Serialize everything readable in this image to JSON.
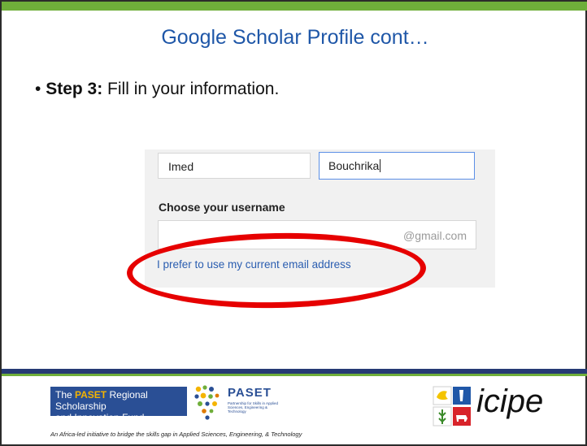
{
  "slide": {
    "title": "Google Scholar Profile cont…",
    "bullet_marker": "•",
    "bullet_bold": "Step 3:",
    "bullet_text": " Fill in your information."
  },
  "form": {
    "first_name_value": "Imed",
    "last_name_value": "Bouchrika",
    "username_label": "Choose your username",
    "username_suffix": "@gmail.com",
    "email_link": "I prefer to use my current email address"
  },
  "footer": {
    "paset_banner_prefix": "The ",
    "paset_banner_highlight": "PASET",
    "paset_banner_rest": " Regional Scholarship",
    "paset_banner_line2": "and Innovation Fund",
    "paset_name": "PASET",
    "paset_desc": "Partnership for Skills in Applied Sciences, Engineering & Technology",
    "tagline": "An Africa-led initiative to bridge the skills gap in Applied Sciences, Engineering, & Technology",
    "icipe_name": "icipe"
  },
  "colors": {
    "accent_green": "#6fae3a",
    "navy": "#263a74",
    "title_blue": "#1f57a8",
    "highlight_red": "#e60000"
  }
}
